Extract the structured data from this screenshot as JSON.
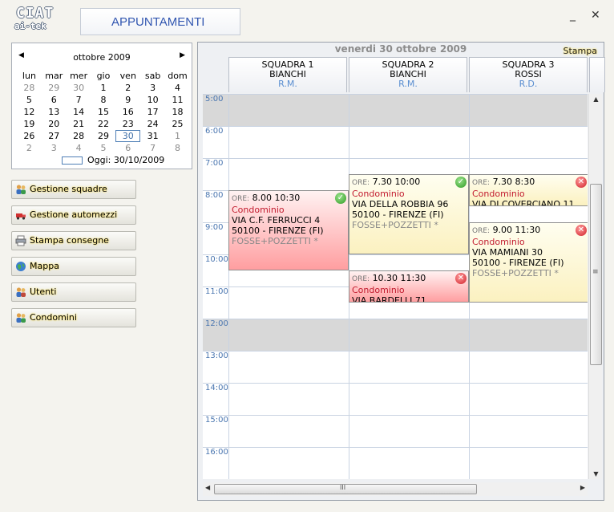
{
  "logo": {
    "line1": "CIAT",
    "line2": "ai-tek"
  },
  "window": {
    "title": "APPUNTAMENTI",
    "minimize": "_",
    "close": "✕"
  },
  "calendar": {
    "month": "ottobre 2009",
    "prev": "◀",
    "next": "▶",
    "weekdays": [
      "lun",
      "mar",
      "mer",
      "gio",
      "ven",
      "sab",
      "dom"
    ],
    "weeks": [
      [
        "28",
        "29",
        "30",
        "1",
        "2",
        "3",
        "4"
      ],
      [
        "5",
        "6",
        "7",
        "8",
        "9",
        "10",
        "11"
      ],
      [
        "12",
        "13",
        "14",
        "15",
        "16",
        "17",
        "18"
      ],
      [
        "19",
        "20",
        "21",
        "22",
        "23",
        "24",
        "25"
      ],
      [
        "26",
        "27",
        "28",
        "29",
        "30",
        "31",
        "1"
      ],
      [
        "2",
        "3",
        "4",
        "5",
        "6",
        "7",
        "8"
      ]
    ],
    "today_label": "Oggi: 30/10/2009"
  },
  "side_buttons": [
    {
      "label": "Gestione squadre",
      "icon": "team-icon"
    },
    {
      "label": "Gestione automezzi",
      "icon": "truck-icon"
    },
    {
      "label": "Stampa consegne",
      "icon": "printer-icon"
    },
    {
      "label": "Mappa",
      "icon": "globe-icon"
    },
    {
      "label": "Utenti",
      "icon": "users-icon"
    },
    {
      "label": "Condomini",
      "icon": "condo-icon"
    }
  ],
  "schedule": {
    "date": "venerdi 30 ottobre 2009",
    "print_label": "Stampa",
    "columns": [
      {
        "team": "SQUADRA 1",
        "name": "BIANCHI",
        "initials": "R.M."
      },
      {
        "team": "SQUADRA 2",
        "name": "BIANCHI",
        "initials": "R.M."
      },
      {
        "team": "SQUADRA 3",
        "name": "ROSSI",
        "initials": "R.D."
      }
    ],
    "hours": [
      "5:00",
      "6:00",
      "7:00",
      "8:00",
      "9:00",
      "10:00",
      "11:00",
      "12:00",
      "13:00",
      "14:00",
      "15:00",
      "16:00"
    ],
    "appointments": [
      {
        "ore": "ORE:",
        "time": "8.00 10:30",
        "tipo": "Condominio",
        "street": "VIA C.F. FERRUCCI 4",
        "city": "50100 - FIRENZE (FI)",
        "service": "FOSSE+POZZETTI *",
        "status": "confirmed"
      },
      {
        "ore": "ORE:",
        "time": "7.30 10:00",
        "tipo": "Condominio",
        "street": "VIA DELLA ROBBIA 96",
        "city": "50100 - FIRENZE (FI)",
        "service": "FOSSE+POZZETTI *",
        "status": "confirmed"
      },
      {
        "ore": "ORE:",
        "time": "10.30 11:30",
        "tipo": "Condominio",
        "street": "VIA BARDELLI 71",
        "city": "",
        "service": "",
        "status": "cancelled"
      },
      {
        "ore": "ORE:",
        "time": "7.30 8:30",
        "tipo": "Condominio",
        "street": "VIA DI COVERCIANO 11",
        "city": "",
        "service": "",
        "status": "cancelled"
      },
      {
        "ore": "ORE:",
        "time": "9.00 11:30",
        "tipo": "Condominio",
        "street": "VIA MAMIANI 30",
        "city": "50100 - FIRENZE (FI)",
        "service": "FOSSE+POZZETTI *",
        "status": "cancelled"
      }
    ],
    "badges": {
      "confirmed": "✓",
      "cancelled": "✕"
    },
    "scroll": {
      "up": "▲",
      "down": "▼",
      "left": "◀",
      "right": "▶",
      "grip": "≡",
      "hgrip": "III"
    }
  }
}
